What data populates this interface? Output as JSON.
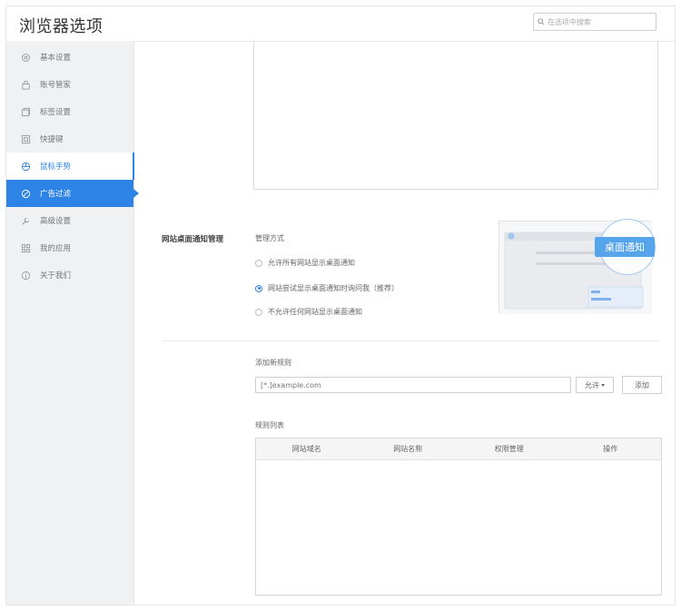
{
  "app": {
    "title": "浏览器选项"
  },
  "search": {
    "placeholder": "在选项中搜索"
  },
  "sidebar": {
    "items": [
      {
        "label": "基本设置",
        "icon": "gear-icon"
      },
      {
        "label": "账号管家",
        "icon": "lock-icon"
      },
      {
        "label": "标签设置",
        "icon": "tabs-icon"
      },
      {
        "label": "快捷键",
        "icon": "keyboard-icon"
      },
      {
        "label": "鼠标手势",
        "icon": "mouse-icon"
      },
      {
        "label": "广告过滤",
        "icon": "block-icon"
      },
      {
        "label": "高级设置",
        "icon": "wrench-icon"
      },
      {
        "label": "我的应用",
        "icon": "apps-icon"
      },
      {
        "label": "关于我们",
        "icon": "info-icon"
      }
    ],
    "hover_index": 4,
    "active_index": 5
  },
  "notify": {
    "section_label": "网站桌面通知管理",
    "mode_heading": "管理方式",
    "options": [
      {
        "label": "允许所有网站显示桌面通知",
        "checked": false
      },
      {
        "label": "网站尝试显示桌面通知时询问我（推荐）",
        "checked": true
      },
      {
        "label": "不允许任何网站显示桌面通知",
        "checked": false
      }
    ],
    "preview_badge": "桌面通知"
  },
  "rules": {
    "add_heading": "添加新规则",
    "input_placeholder": "[*.]example.com",
    "permission_select": "允许",
    "add_button": "添加",
    "list_heading": "规则列表",
    "columns": [
      "网站域名",
      "网站名称",
      "权限管理",
      "操作"
    ]
  },
  "colors": {
    "accent": "#2e84e6",
    "sidebar_bg": "#f0f1f3"
  }
}
